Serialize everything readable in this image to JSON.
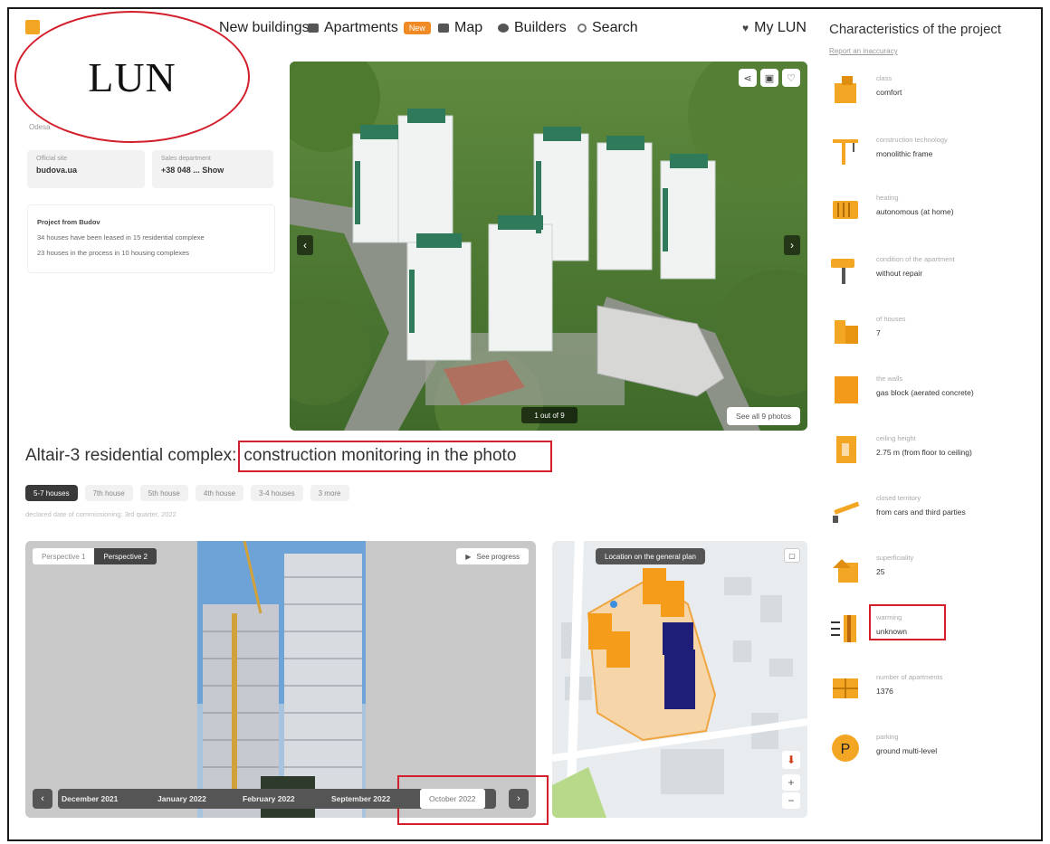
{
  "brand": {
    "annotation": "LUN",
    "city": "Odesa"
  },
  "nav": {
    "new_buildings": "New buildings",
    "apartments": "Apartments",
    "apartments_badge": "New",
    "map": "Map",
    "builders": "Builders",
    "search": "Search",
    "my_lun": "My LUN"
  },
  "contacts": {
    "official_label": "Official site",
    "official_value": "budova.ua",
    "sales_label": "Sales department",
    "sales_value": "+38 048 ...  Show"
  },
  "project": {
    "title": "Project from Budov",
    "line1": "34 houses have been leased in 15 residential complexe",
    "line2": "23 houses in the process in 10 housing complexes"
  },
  "hero": {
    "counter": "1 out of 9",
    "see_all": "See all 9 photos",
    "prev": "‹",
    "next": "›",
    "share_icon": "share",
    "comment_icon": "comment",
    "favorite_icon": "heart"
  },
  "heading": {
    "prefix": "Altair-3 residential complex:",
    "highlight": "construction monitoring in the photo"
  },
  "house_tabs": [
    "5-7 houses",
    "7th house",
    "5th house",
    "4th house",
    "3-4 houses",
    "3 more"
  ],
  "declared": "declared date of commissioning: 3rd quarter, 2022",
  "progress": {
    "perspective1": "Perspective 1",
    "perspective2": "Perspective 2",
    "see_progress": "See progress",
    "prev": "‹",
    "next": "›",
    "months": [
      "December 2021",
      "January 2022",
      "February 2022",
      "September 2022",
      "October 2022"
    ]
  },
  "map": {
    "label": "Location on the general plan",
    "zoom_in": "+",
    "zoom_out": "−"
  },
  "side": {
    "title": "Characteristics of the project",
    "report": "Report an inaccuracy",
    "items": [
      {
        "label": "class",
        "value": "comfort",
        "icon": "building-icon"
      },
      {
        "label": "construction technology",
        "value": "monolithic frame",
        "icon": "crane-icon"
      },
      {
        "label": "heating",
        "value": "autonomous (at home)",
        "icon": "heater-icon"
      },
      {
        "label": "condition of the apartment",
        "value": "without repair",
        "icon": "paint-roller-icon"
      },
      {
        "label": "of houses",
        "value": "7",
        "icon": "houses-icon"
      },
      {
        "label": "the walls",
        "value": "gas block (aerated concrete)",
        "icon": "wall-icon"
      },
      {
        "label": "ceiling height",
        "value": "2.75 m (from floor to ceiling)",
        "icon": "ceiling-height-icon"
      },
      {
        "label": "closed territory",
        "value": "from cars and third parties",
        "icon": "barrier-icon"
      },
      {
        "label": "superficiality",
        "value": "25",
        "icon": "floors-icon"
      },
      {
        "label": "warming",
        "value": "unknown",
        "icon": "insulation-icon"
      },
      {
        "label": "number of apartments",
        "value": "1376",
        "icon": "apartments-icon"
      },
      {
        "label": "parking",
        "value": "ground multi-level",
        "icon": "parking-icon"
      }
    ]
  },
  "colors": {
    "accent": "#f3a623",
    "annotation_red": "#d21f2b",
    "dark": "#3a3a3a"
  }
}
